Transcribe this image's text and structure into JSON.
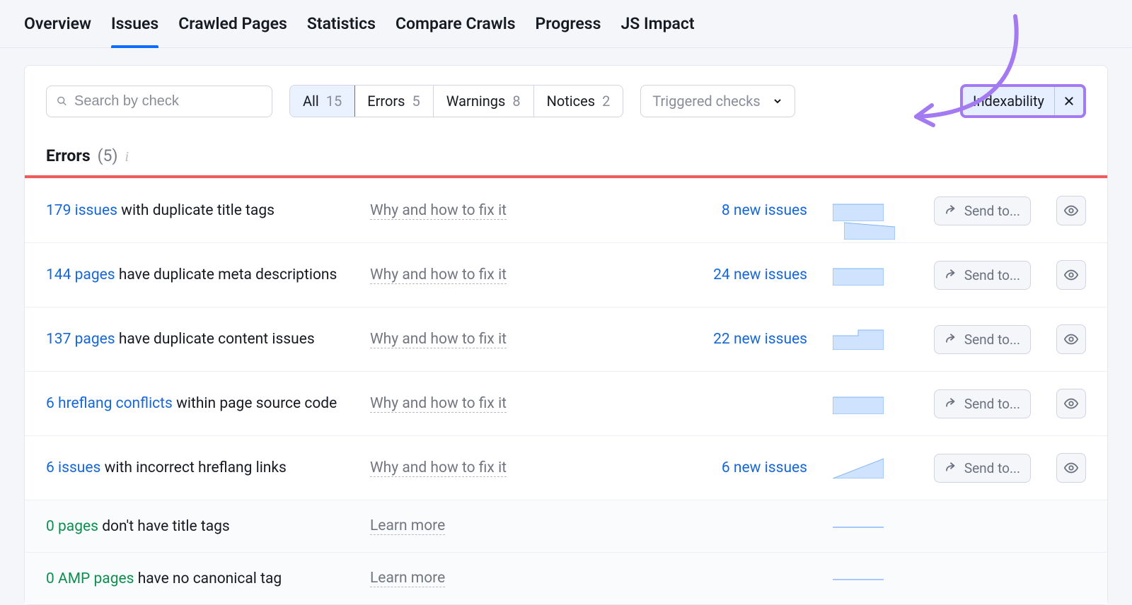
{
  "tabs": [
    {
      "label": "Overview"
    },
    {
      "label": "Issues",
      "active": true
    },
    {
      "label": "Crawled Pages"
    },
    {
      "label": "Statistics"
    },
    {
      "label": "Compare Crawls"
    },
    {
      "label": "Progress"
    },
    {
      "label": "JS Impact"
    }
  ],
  "search": {
    "placeholder": "Search by check"
  },
  "filters": {
    "all": {
      "label": "All",
      "count": "15"
    },
    "errors": {
      "label": "Errors",
      "count": "5"
    },
    "warnings": {
      "label": "Warnings",
      "count": "8"
    },
    "notices": {
      "label": "Notices",
      "count": "2"
    }
  },
  "triggered_label": "Triggered checks",
  "tag": {
    "label": "Indexability"
  },
  "section": {
    "title": "Errors",
    "count": "(5)"
  },
  "send_label": "Send to...",
  "rows": [
    {
      "link": "179 issues",
      "rest": " with duplicate title tags",
      "why": "Why and how to fix it",
      "new": "8 new issues",
      "spark": "rect"
    },
    {
      "link": "144 pages",
      "rest": " have duplicate meta descriptions",
      "why": "Why and how to fix it",
      "new": "24 new issues",
      "spark": "rect"
    },
    {
      "link": "137 pages",
      "rest": " have duplicate content issues",
      "why": "Why and how to fix it",
      "new": "22 new issues",
      "spark": "step"
    },
    {
      "link": "6 hreflang conflicts",
      "rest": " within page source code",
      "why": "Why and how to fix it",
      "new": "",
      "spark": "rect"
    },
    {
      "link": "6 issues",
      "rest": " with incorrect hreflang links",
      "why": "Why and how to fix it",
      "new": "6 new issues",
      "spark": "tri"
    }
  ],
  "zero_rows": [
    {
      "link": "0 pages",
      "rest": " don't have title tags",
      "learn": "Learn more"
    },
    {
      "link": "0 AMP pages",
      "rest": " have no canonical tag",
      "learn": "Learn more"
    }
  ]
}
